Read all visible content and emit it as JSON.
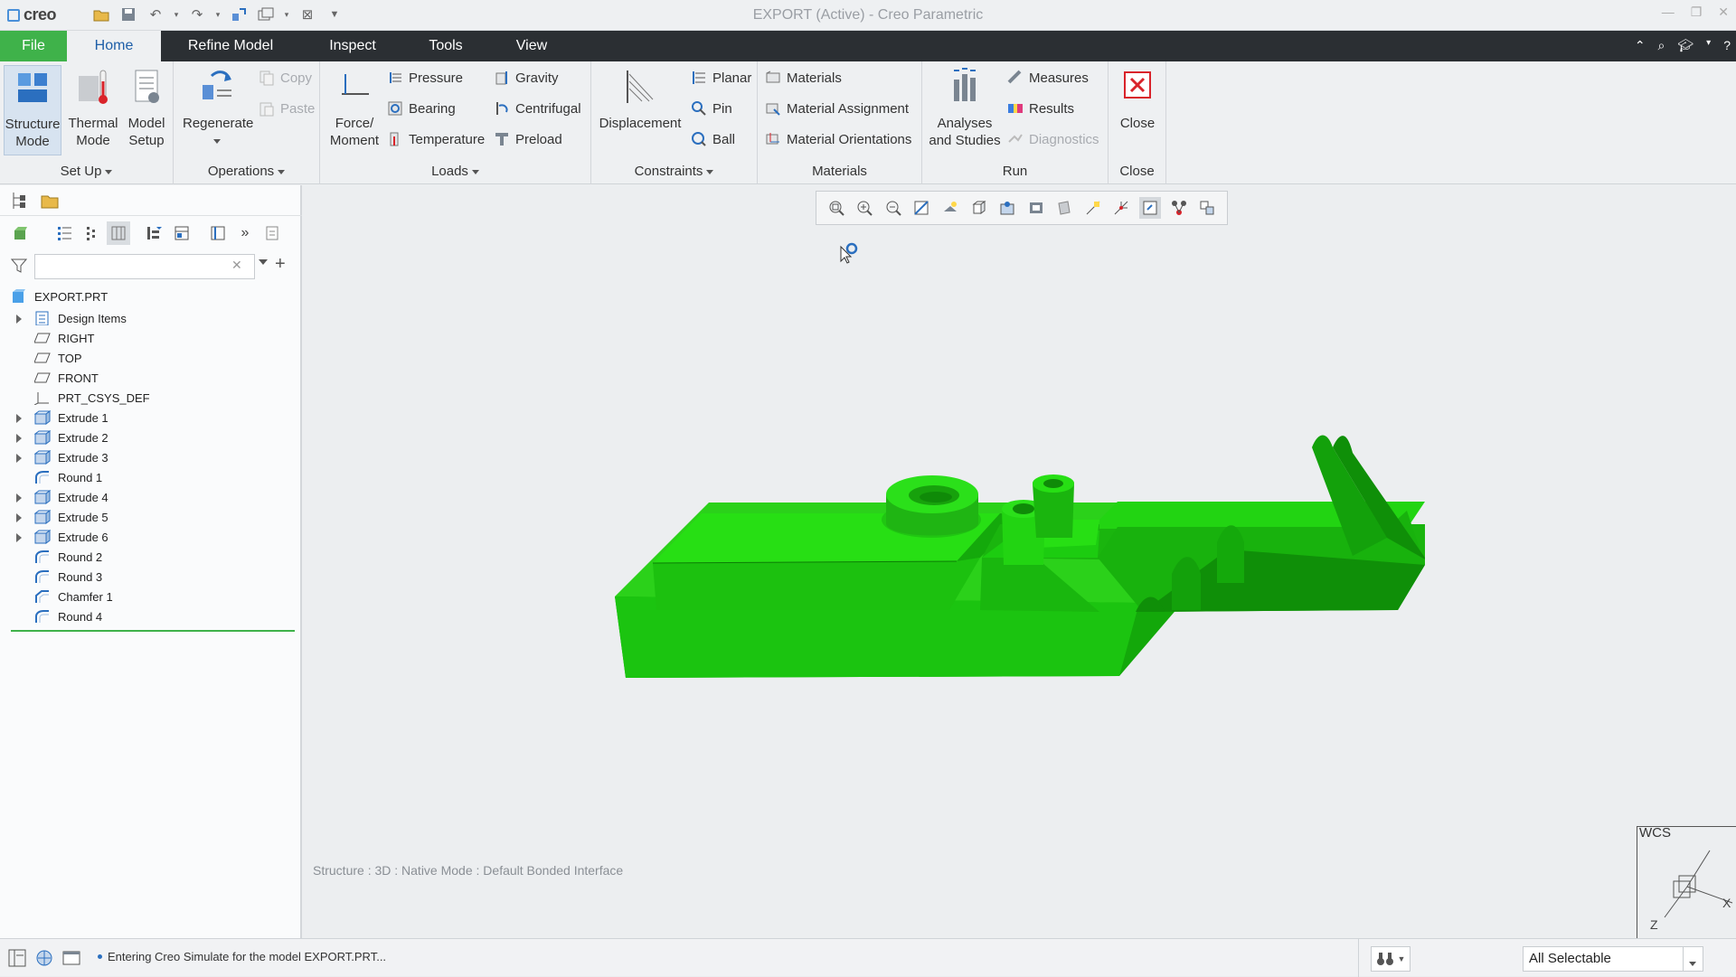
{
  "app": {
    "logo": "creo",
    "window_title": "EXPORT (Active) - Creo Parametric"
  },
  "tabs": {
    "file": "File",
    "home": "Home",
    "refine_model": "Refine Model",
    "inspect": "Inspect",
    "tools": "Tools",
    "view": "View"
  },
  "ribbon": {
    "setup": {
      "label": "Set Up",
      "structure_mode": "Structure Mode",
      "thermal_mode": "Thermal Mode",
      "model_setup": "Model Setup"
    },
    "operations": {
      "label": "Operations",
      "regenerate": "Regenerate",
      "copy": "Copy",
      "paste": "Paste"
    },
    "loads": {
      "label": "Loads",
      "force_moment": "Force/ Moment",
      "pressure": "Pressure",
      "bearing": "Bearing",
      "temperature": "Temperature",
      "gravity": "Gravity",
      "centrifugal": "Centrifugal",
      "preload": "Preload"
    },
    "constraints": {
      "label": "Constraints",
      "displacement": "Displacement",
      "planar": "Planar",
      "pin": "Pin",
      "ball": "Ball"
    },
    "materials": {
      "label": "Materials",
      "materials": "Materials",
      "material_assignment": "Material Assignment",
      "material_orientations": "Material Orientations"
    },
    "run": {
      "label": "Run",
      "analyses_studies": "Analyses and Studies",
      "measures": "Measures",
      "results": "Results",
      "diagnostics": "Diagnostics"
    },
    "close": {
      "label": "Close",
      "close": "Close"
    }
  },
  "model_tree": {
    "root": "EXPORT.PRT",
    "items": [
      {
        "label": "Design Items",
        "icon": "design-items-icon",
        "expandable": true
      },
      {
        "label": "RIGHT",
        "icon": "datum-plane-icon",
        "expandable": false
      },
      {
        "label": "TOP",
        "icon": "datum-plane-icon",
        "expandable": false
      },
      {
        "label": "FRONT",
        "icon": "datum-plane-icon",
        "expandable": false
      },
      {
        "label": "PRT_CSYS_DEF",
        "icon": "csys-icon",
        "expandable": false
      },
      {
        "label": "Extrude 1",
        "icon": "extrude-icon",
        "expandable": true
      },
      {
        "label": "Extrude 2",
        "icon": "extrude-icon",
        "expandable": true
      },
      {
        "label": "Extrude 3",
        "icon": "extrude-icon",
        "expandable": true
      },
      {
        "label": "Round 1",
        "icon": "round-icon",
        "expandable": false
      },
      {
        "label": "Extrude 4",
        "icon": "extrude-icon",
        "expandable": true
      },
      {
        "label": "Extrude 5",
        "icon": "extrude-icon",
        "expandable": true
      },
      {
        "label": "Extrude 6",
        "icon": "extrude-icon",
        "expandable": true
      },
      {
        "label": "Round 2",
        "icon": "round-icon",
        "expandable": false
      },
      {
        "label": "Round 3",
        "icon": "round-icon",
        "expandable": false
      },
      {
        "label": "Chamfer 1",
        "icon": "chamfer-icon",
        "expandable": false
      },
      {
        "label": "Round 4",
        "icon": "round-icon",
        "expandable": false
      }
    ]
  },
  "graphics": {
    "model_status": "Structure : 3D : Native Mode : Default Bonded Interface",
    "wcs_label": "WCS",
    "axis_x": "X",
    "axis_z": "Z",
    "model_color": "#22dd10"
  },
  "status": {
    "message": "Entering Creo Simulate for the model EXPORT.PRT...",
    "selection_filter": "All Selectable"
  },
  "colors": {
    "file_tab": "#3fb24a",
    "tabbar": "#2b2f33",
    "accent": "#1f5fa8",
    "close_red": "#d9232a"
  }
}
